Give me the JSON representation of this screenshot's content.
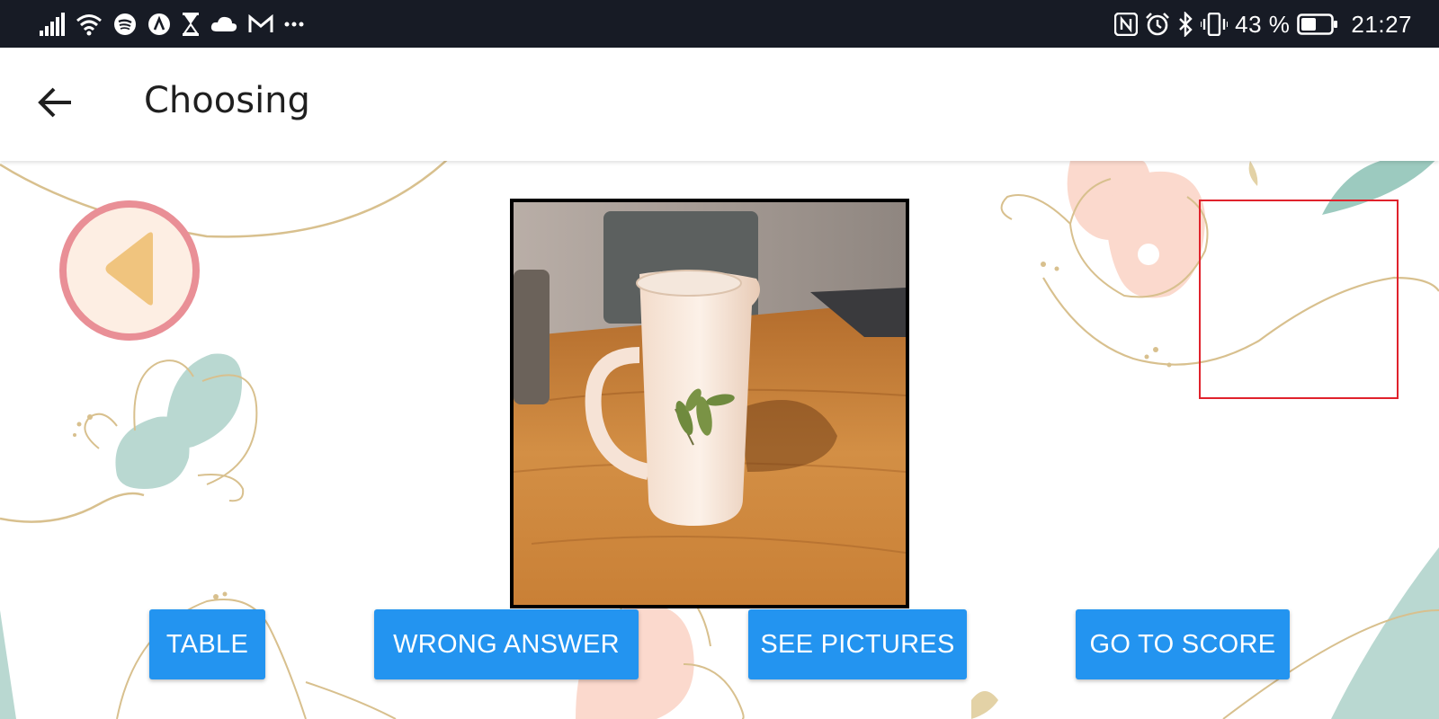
{
  "status_bar": {
    "battery_percent": "43 %",
    "time": "21:27",
    "left_icons": [
      "signal-icon",
      "wifi-icon",
      "spotify-icon",
      "app-a-icon",
      "hourglass-icon",
      "cloud-icon",
      "gmail-icon",
      "more-dots-icon"
    ],
    "right_icons": [
      "nfc-icon",
      "alarm-icon",
      "bluetooth-icon",
      "vibrate-icon",
      "battery-icon"
    ]
  },
  "app_bar": {
    "title": "Choosing",
    "back_icon": "arrow-back-icon"
  },
  "main": {
    "prev_icon": "triangle-left-icon",
    "photo_subject": "pitcher-photo"
  },
  "buttons": {
    "table": "TABLE",
    "wrong_answer": "WRONG ANSWER",
    "see_pictures": "SEE PICTURES",
    "go_to_score": "GO TO SCORE"
  },
  "colors": {
    "status_bar_bg": "#171b25",
    "button_bg": "#2394f0",
    "prev_ring": "#e98f96",
    "prev_fill": "#fdeee3",
    "prev_triangle": "#f0c47e",
    "target_border": "#e0222c"
  }
}
